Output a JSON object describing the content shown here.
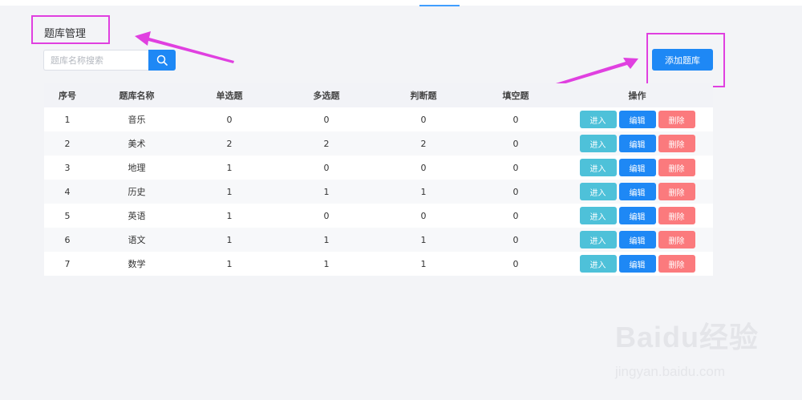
{
  "page": {
    "title": "题库管理",
    "accent_color": "#1e88f5"
  },
  "search": {
    "placeholder": "题库名称搜索",
    "value": "",
    "icon": "search-icon"
  },
  "toolbar": {
    "add_label": "添加题库"
  },
  "table": {
    "columns": [
      "序号",
      "题库名称",
      "单选题",
      "多选题",
      "判断题",
      "填空题",
      "操作"
    ],
    "actions": {
      "enter": "进入",
      "edit": "编辑",
      "delete": "删除"
    },
    "rows": [
      {
        "index": "1",
        "name": "音乐",
        "single": "0",
        "multiple": "0",
        "judge": "0",
        "blank": "0"
      },
      {
        "index": "2",
        "name": "美术",
        "single": "2",
        "multiple": "2",
        "judge": "2",
        "blank": "0"
      },
      {
        "index": "3",
        "name": "地理",
        "single": "1",
        "multiple": "0",
        "judge": "0",
        "blank": "0"
      },
      {
        "index": "4",
        "name": "历史",
        "single": "1",
        "multiple": "1",
        "judge": "1",
        "blank": "0"
      },
      {
        "index": "5",
        "name": "英语",
        "single": "1",
        "multiple": "0",
        "judge": "0",
        "blank": "0"
      },
      {
        "index": "6",
        "name": "语文",
        "single": "1",
        "multiple": "1",
        "judge": "1",
        "blank": "0"
      },
      {
        "index": "7",
        "name": "数学",
        "single": "1",
        "multiple": "1",
        "judge": "1",
        "blank": "0"
      }
    ]
  },
  "watermark": {
    "brand": "Baidu经验",
    "url": "jingyan.baidu.com"
  }
}
